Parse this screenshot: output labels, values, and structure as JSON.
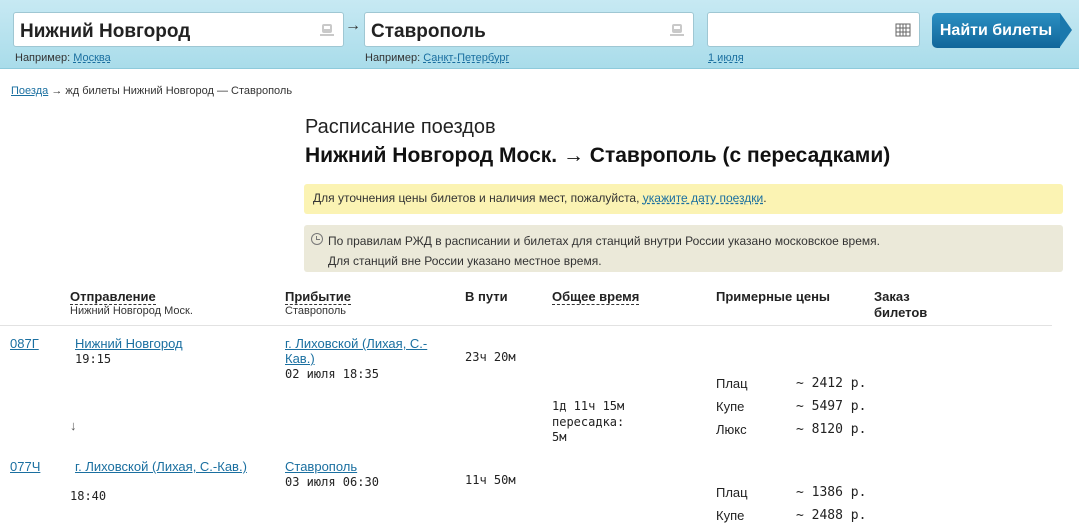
{
  "search": {
    "from_value": "Нижний Новгород",
    "to_value": "Ставрополь",
    "date_value": "",
    "from_hint_prefix": "Например:",
    "from_hint_link": "Москва",
    "to_hint_prefix": "Например:",
    "to_hint_link": "Санкт-Петербург",
    "date_hint_link": "1 июля",
    "arrow": "→",
    "find_button": "Найти билеты"
  },
  "breadcrumb": {
    "link": "Поезда",
    "sep": "→",
    "current": "жд билеты Нижний Новгород — Ставрополь"
  },
  "page": {
    "title": "Расписание поездов",
    "subtitle": "Нижний Новгород Моск. → Ставрополь (с пересадками)"
  },
  "notes": {
    "yellow_text": "Для уточнения цены билетов и наличия мест, пожалуйста, ",
    "yellow_link": "укажите дату поездки",
    "yellow_end": ".",
    "grey_line1": "По правилам РЖД в расписании и билетах для станций внутри России указано московское время.",
    "grey_line2": "Для станций вне России указано местное время."
  },
  "table": {
    "headers": {
      "departure": "Отправление",
      "departure_sub": "Нижний Новгород Моск.",
      "arrival": "Прибытие",
      "arrival_sub": "Ставрополь",
      "travel": "В пути",
      "total": "Общее время",
      "prices": "Примерные цены",
      "order": "Заказ билетов"
    },
    "segment1": {
      "train": "087Г",
      "dep_station": "Нижний Новгород",
      "dep_time": "19:15",
      "arr_station": "г. Лиховской (Лихая, С.-Кав.)",
      "arr_datetime": "02 июля 18:35",
      "travel": "23ч 20м",
      "transfer_arrow": "↓",
      "total_time": "1д 11ч 15м",
      "transfer_label": "пересадка:",
      "transfer_time": "5м",
      "prices": [
        {
          "label": "Плац",
          "value": "~ 2412 р."
        },
        {
          "label": "Купе",
          "value": "~ 5497 р."
        },
        {
          "label": "Люкс",
          "value": "~ 8120 р."
        }
      ]
    },
    "segment2": {
      "train": "077Ч",
      "dep_station": "г. Лиховской (Лихая, С.-Кав.)",
      "dep_time": "18:40",
      "arr_station": "Ставрополь",
      "arr_datetime": "03 июля 06:30",
      "travel": "11ч 50м",
      "prices": [
        {
          "label": "Плац",
          "value": "~ 1386 р."
        },
        {
          "label": "Купе",
          "value": "~ 2488 р."
        }
      ]
    }
  }
}
